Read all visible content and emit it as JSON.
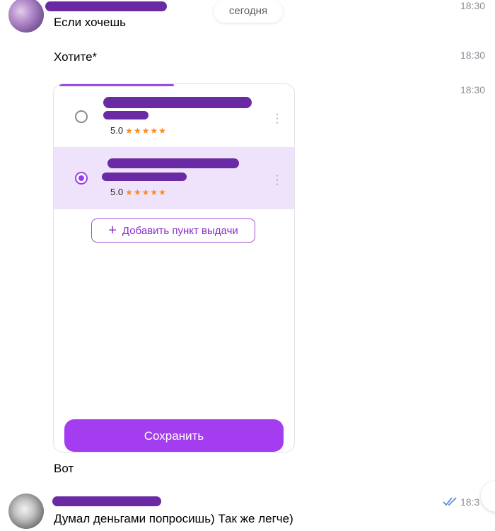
{
  "date_divider": "сегодня",
  "messages": [
    {
      "text": "Если хочешь",
      "time": "18:30"
    },
    {
      "text": "Хотите*",
      "time": "18:30"
    },
    {
      "time": "18:30"
    },
    {
      "text": "Вот"
    },
    {
      "text": "Думал деньгами попросишь) Так же легче)",
      "time": "18:3"
    }
  ],
  "pickup_card": {
    "options": [
      {
        "rating": "5.0",
        "stars": "★★★★★",
        "selected": false
      },
      {
        "rating": "5.0",
        "stars": "★★★★★",
        "selected": true
      }
    ],
    "add_button_label": "Добавить пункт выдачи",
    "save_button_label": "Сохранить"
  },
  "colors": {
    "accent": "#a43df0",
    "selected_bg": "#efe3fb",
    "star": "#ff8a1f",
    "redaction": "#6a2aa3"
  }
}
